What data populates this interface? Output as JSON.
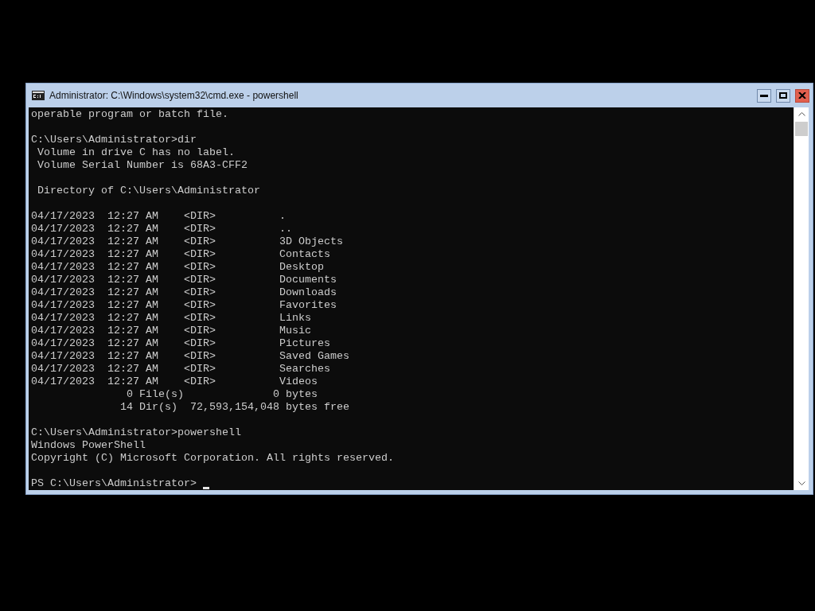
{
  "window": {
    "title": "Administrator: C:\\Windows\\system32\\cmd.exe - powershell"
  },
  "console": {
    "blocks": [
      [
        "operable program or batch file."
      ],
      [
        "C:\\Users\\Administrator>dir",
        " Volume in drive C has no label.",
        " Volume Serial Number is 68A3-CFF2"
      ],
      [
        " Directory of C:\\Users\\Administrator"
      ],
      [
        "04/17/2023  12:27 AM    <DIR>          .",
        "04/17/2023  12:27 AM    <DIR>          ..",
        "04/17/2023  12:27 AM    <DIR>          3D Objects",
        "04/17/2023  12:27 AM    <DIR>          Contacts",
        "04/17/2023  12:27 AM    <DIR>          Desktop",
        "04/17/2023  12:27 AM    <DIR>          Documents",
        "04/17/2023  12:27 AM    <DIR>          Downloads",
        "04/17/2023  12:27 AM    <DIR>          Favorites",
        "04/17/2023  12:27 AM    <DIR>          Links",
        "04/17/2023  12:27 AM    <DIR>          Music",
        "04/17/2023  12:27 AM    <DIR>          Pictures",
        "04/17/2023  12:27 AM    <DIR>          Saved Games",
        "04/17/2023  12:27 AM    <DIR>          Searches",
        "04/17/2023  12:27 AM    <DIR>          Videos",
        "               0 File(s)              0 bytes",
        "              14 Dir(s)  72,593,154,048 bytes free"
      ],
      [
        "C:\\Users\\Administrator>powershell",
        "Windows PowerShell",
        "Copyright (C) Microsoft Corporation. All rights reserved."
      ],
      [
        "PS C:\\Users\\Administrator> "
      ]
    ]
  }
}
